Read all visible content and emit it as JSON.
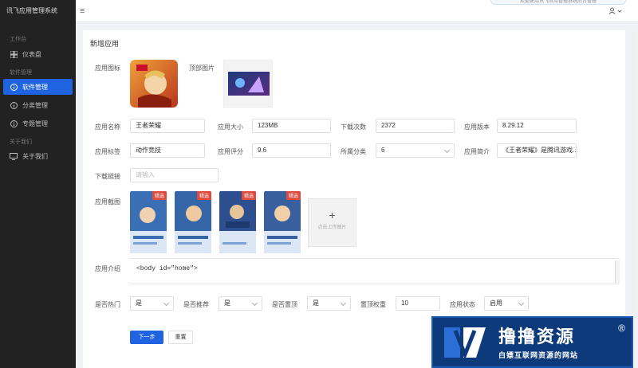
{
  "app": {
    "title": "讯飞应用管理系统"
  },
  "sidebar": {
    "groups": [
      {
        "title": "工作台",
        "items": [
          {
            "label": "仪表盘",
            "icon": "grid-icon",
            "active": false
          }
        ]
      },
      {
        "title": "软件管理",
        "items": [
          {
            "label": "软件管理",
            "icon": "info-circle-icon",
            "active": true
          },
          {
            "label": "分类管理",
            "icon": "info-circle-icon",
            "active": false
          },
          {
            "label": "专题管理",
            "icon": "info-circle-icon",
            "active": false
          }
        ]
      },
      {
        "title": "关于我们",
        "items": [
          {
            "label": "关于我们",
            "icon": "monitor-icon",
            "active": false
          }
        ]
      }
    ]
  },
  "topbar": {
    "menu_icon": "≡",
    "notice": "欢迎使用讯飞应用管理系统后台管理",
    "user_icon": "user-icon"
  },
  "form": {
    "title": "新增应用",
    "labels": {
      "app_icon": "应用图标",
      "top_image": "顶部图片",
      "app_name": "应用名称",
      "app_size": "应用大小",
      "downloads": "下载次数",
      "version": "应用版本",
      "tags": "应用标签",
      "rating": "应用评分",
      "category": "所属分类",
      "summary": "应用简介",
      "download_url": "下载链接",
      "screenshots": "应用截图",
      "intro": "应用介绍",
      "is_hot": "是否热门",
      "is_recommend": "是否推荐",
      "is_top": "是否置顶",
      "weight": "置顶权重",
      "status": "应用状态"
    },
    "values": {
      "app_name": "王者荣耀",
      "app_size": "123MB",
      "downloads": "2372",
      "version": "8.29.12",
      "tags": "动作竞技",
      "rating": "9.6",
      "category": "6",
      "summary": "《王者荣耀》是腾讯游戏...",
      "download_url_placeholder": "请输入",
      "intro": "<body id=\"home\">",
      "is_hot": "是",
      "is_recommend": "是",
      "is_top": "是",
      "weight": "10",
      "status": "启用"
    },
    "screenshot_tag": "精选",
    "upload_label": "点击上传图片",
    "upload_plus": "+",
    "buttons": {
      "next": "下一步",
      "reset": "重置"
    }
  },
  "watermark": {
    "title": "撸撸资源",
    "reg": "®",
    "subtitle": "白嫖互联网资源的网站"
  },
  "colors": {
    "primary": "#1f63e0",
    "sidebar_bg": "#222222",
    "tag_red": "#e04a3f"
  }
}
